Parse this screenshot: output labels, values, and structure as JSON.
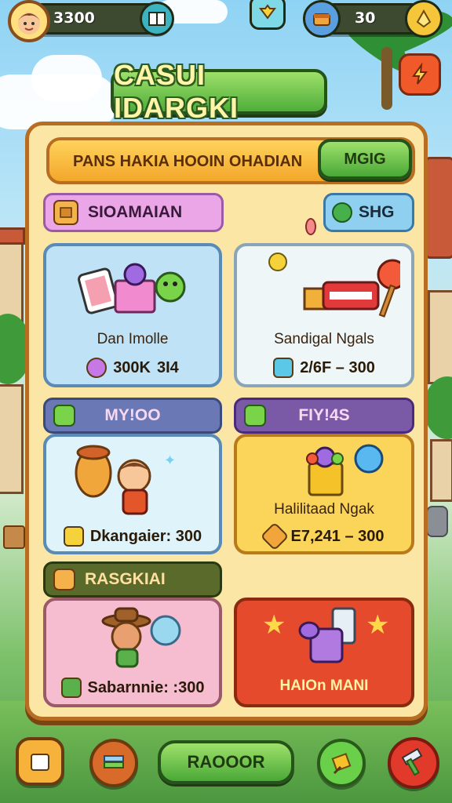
{
  "hud": {
    "coins": "3300",
    "gems": "30"
  },
  "title": "CASUI IDARGKI",
  "panel": {
    "header_text": "PANS HAKIA HOOIN OHADIAN",
    "header_button": "MGIG"
  },
  "sections": {
    "section1_title": "SIOAMAIAN",
    "section1_badge": "SHG",
    "section2_left_title": "MY!OO",
    "section2_right_title": "FIY!4S",
    "section3_title": "RASGKIAI"
  },
  "cards": [
    {
      "label": "Dan Imolle",
      "price_a": "300K",
      "price_b": "3I4"
    },
    {
      "label": "Sandigal Ngals",
      "price": "2/6F – 300"
    },
    {
      "price": "Dkangaier: 300"
    },
    {
      "label": "Halilitaad Ngak",
      "price": "E7,241 – 300"
    },
    {
      "price": "Sabarnnie: :300"
    },
    {
      "label": "HAIOn MANI"
    }
  ],
  "bottom": {
    "main_button": "RAOOOR"
  },
  "colors": {
    "accent_green": "#4aa837",
    "panel_bg": "#fbe6a6",
    "panel_border": "#b86e22",
    "purple_tab": "#7a5aa6",
    "dark_tab": "#5a5a2a",
    "red_card": "#e0452c"
  }
}
